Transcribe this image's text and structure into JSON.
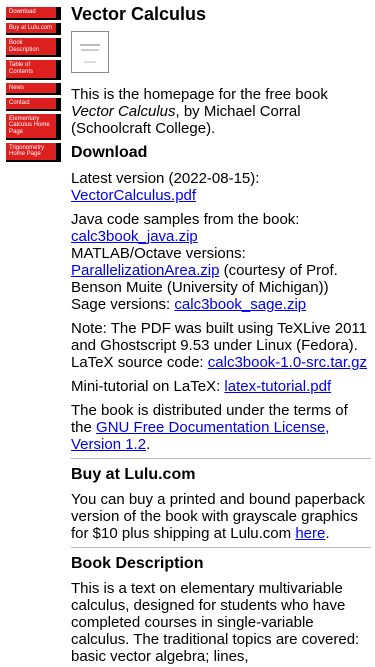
{
  "nav": {
    "items": [
      {
        "label": "Download"
      },
      {
        "label": "Buy at Lulu.com"
      },
      {
        "label": "Book Description"
      },
      {
        "label": "Table of Contents"
      },
      {
        "label": "News"
      },
      {
        "label": "Contact"
      },
      {
        "label": "Elementary Calculus Home Page"
      },
      {
        "label": "Trigonometry Home Page"
      }
    ]
  },
  "page": {
    "title": "Vector Calculus",
    "intro": {
      "before": "This is the homepage for the free book ",
      "book": "Vector Calculus",
      "after": ", by Michael Corral (Schoolcraft College)."
    }
  },
  "download": {
    "heading": "Download",
    "latest_text": "Latest version (2022-08-15):",
    "latest_link": "VectorCalculus.pdf",
    "java_text": "Java code samples from the book:",
    "java_link": "calc3book_java.zip",
    "matlab_text": "MATLAB/Octave versions:",
    "matlab_link": "ParallelizationArea.zip",
    "matlab_after": " (courtesy of Prof. Benson Muite (University of Michigan))",
    "sage_text": "Sage versions: ",
    "sage_link": "calc3book_sage.zip",
    "note_text": "Note: The PDF was built using TeXLive 2011 and Ghostscript 9.53 under Linux (Fedora).",
    "latex_text": "LaTeX source code: ",
    "latex_link": "calc3book-1.0-src.tar.gz",
    "tutorial_text": "Mini-tutorial on LaTeX: ",
    "tutorial_link": "latex-tutorial.pdf",
    "license_before": "The book is distributed under the terms of the ",
    "license_link": "GNU Free Documentation License, Version 1.2",
    "license_after": "."
  },
  "lulu": {
    "heading": "Buy at Lulu.com",
    "text": "You can buy a printed and bound paperback version of the book with grayscale graphics for $10 plus shipping at Lulu.com ",
    "link": "here",
    "after": "."
  },
  "description": {
    "heading": "Book Description",
    "text": "This is a text on elementary multivariable calculus, designed for students who have completed courses in single-variable calculus. The traditional topics are covered: basic vector algebra; lines,"
  },
  "colors": {
    "nav_bg": "#dd1f1f",
    "link": "#0000ee"
  }
}
